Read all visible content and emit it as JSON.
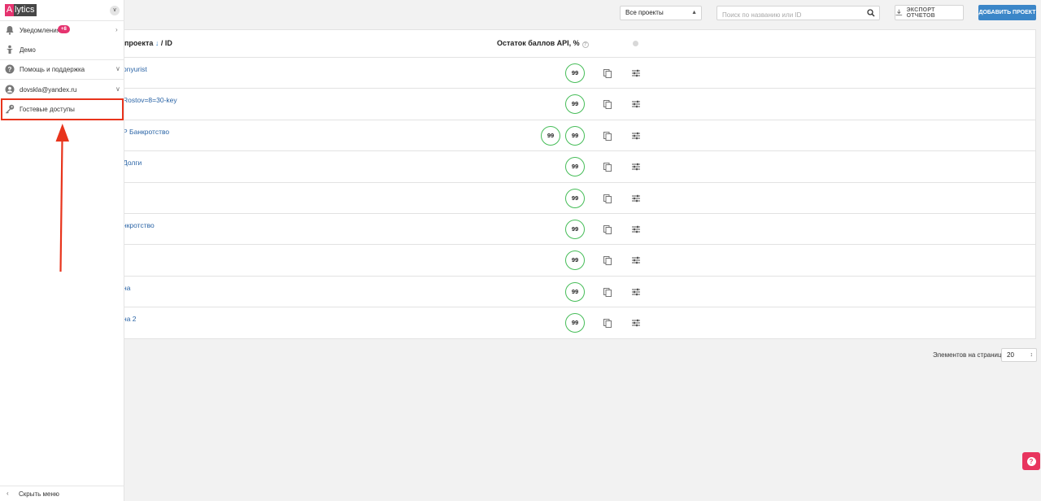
{
  "toolbar": {
    "project_filter": "Все проекты",
    "search_placeholder": "Поиск по названию или ID",
    "export_label": "ЭКСПОРТ ОТЧЕТОВ",
    "add_label": "ДОБАВИТЬ ПРОЕКТ"
  },
  "table": {
    "col_name": "проекта",
    "col_name_suffix": "/ ID",
    "col_api": "Остаток баллов API, %",
    "rows": [
      {
        "name": "pnyurist",
        "api": "99"
      },
      {
        "name": "Rostov=8=30-key",
        "api": "99"
      },
      {
        "name": "Р Банкротство",
        "api": "99",
        "api_extra": "99"
      },
      {
        "name": "Долги",
        "api": "99"
      },
      {
        "name": "",
        "api": "99"
      },
      {
        "name": "нкротство",
        "api": "99"
      },
      {
        "name": "",
        "api": "99"
      },
      {
        "name": "на",
        "api": "99"
      },
      {
        "name": "на 2",
        "api": "99"
      }
    ]
  },
  "pagination": {
    "label": "Элементов на странице:",
    "value": "20"
  },
  "sidebar": {
    "logo_first": "A",
    "logo_rest": "lytics",
    "items": [
      {
        "label": "Уведомления",
        "badge": "+8"
      },
      {
        "label": "Демо"
      },
      {
        "label": "Помощь и поддержка"
      },
      {
        "label": "dovskla@yandex.ru"
      },
      {
        "label": "Гостевые доступы"
      }
    ],
    "hide_menu": "Скрыть меню"
  },
  "colors": {
    "accent": "#3b86c8",
    "brand_pink": "#e5336f",
    "highlight_red": "#e8341c",
    "api_ring": "#46bd58"
  }
}
